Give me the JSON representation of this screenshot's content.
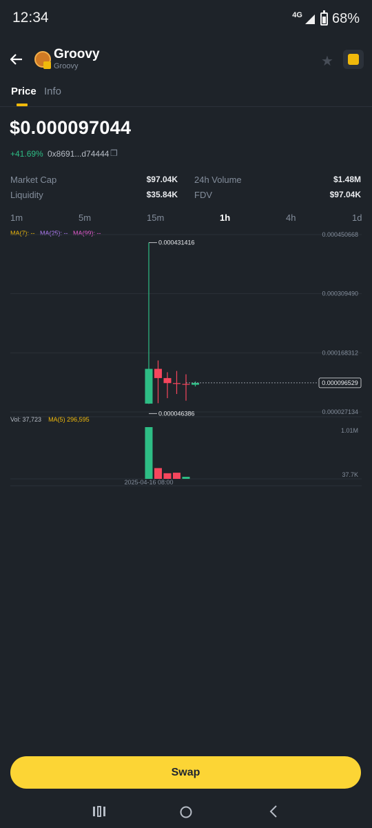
{
  "status_bar": {
    "time": "12:34",
    "network": "4G",
    "battery": "68%",
    "battery_level": 0.68
  },
  "header": {
    "token_name": "Groovy",
    "token_subtitle": "Groovy",
    "back_icon": "arrow-left-icon",
    "favorite_icon": "star-icon",
    "chain_icon": "bnb-chain-icon"
  },
  "tabs": [
    {
      "label": "Price",
      "active": true
    },
    {
      "label": "Info",
      "active": false
    }
  ],
  "price": {
    "value": "$0.000097044",
    "change": "+41.69%",
    "address": "0x8691...d74444",
    "copy_icon": "copy-icon"
  },
  "stats": {
    "market_cap_label": "Market Cap",
    "market_cap": "$97.04K",
    "volume_label": "24h Volume",
    "volume": "$1.48M",
    "liquidity_label": "Liquidity",
    "liquidity": "$35.84K",
    "fdv_label": "FDV",
    "fdv": "$97.04K"
  },
  "intervals": [
    {
      "label": "1m"
    },
    {
      "label": "5m"
    },
    {
      "label": "15m"
    },
    {
      "label": "1h",
      "active": true
    },
    {
      "label": "4h"
    },
    {
      "label": "1d"
    }
  ],
  "indicators": {
    "ma7": "MA(7): --",
    "ma25": "MA(25): --",
    "ma99": "MA(99): --"
  },
  "volume_header": {
    "vol": "Vol: 37,723",
    "ma5": "MA(5) 296,595"
  },
  "colors": {
    "up": "#2ebd85",
    "down": "#f6465d",
    "accent": "#fcd535",
    "ma7": "#f0b90b",
    "ma25": "#b27cf7",
    "ma99": "#e85bd2"
  },
  "chart_data": {
    "type": "candlestick",
    "y_ticks": [
      "0.000450668",
      "0.000309490",
      "0.000168312",
      "0.000027134"
    ],
    "ylim": [
      2.7134e-05,
      0.000450668
    ],
    "high_label": "0.000431416",
    "low_label": "0.000046386",
    "current_price_label": "0.000096529",
    "candles": [
      {
        "open": 4.7e-05,
        "high": 0.000431416,
        "low": 4.6386e-05,
        "close": 0.00013,
        "up": true
      },
      {
        "open": 0.00013,
        "high": 0.00015,
        "low": 4.8e-05,
        "close": 0.000108,
        "up": false
      },
      {
        "open": 0.000108,
        "high": 0.000122,
        "low": 6e-05,
        "close": 9.6e-05,
        "up": false
      },
      {
        "open": 9.6e-05,
        "high": 0.000125,
        "low": 7e-05,
        "close": 9.4e-05,
        "up": false
      },
      {
        "open": 9.4e-05,
        "high": 0.000117,
        "low": 5.4e-05,
        "close": 9.2e-05,
        "up": false
      },
      {
        "open": 9.2e-05,
        "high": 0.0001,
        "low": 8.8e-05,
        "close": 9.6529e-05,
        "up": true
      }
    ],
    "volume": {
      "y_ticks": [
        "1.01M",
        "37.7K"
      ],
      "ylim": [
        0,
        1010000
      ],
      "values": [
        1010000,
        210000,
        110000,
        120000,
        40000,
        0
      ],
      "up": [
        true,
        false,
        false,
        false,
        true,
        true
      ]
    },
    "x_label": "2025-04-16 08:00"
  },
  "actions": {
    "swap": "Swap"
  },
  "nav": {
    "recents_icon": "recents-icon",
    "home_icon": "home-icon",
    "back_icon": "back-icon"
  }
}
